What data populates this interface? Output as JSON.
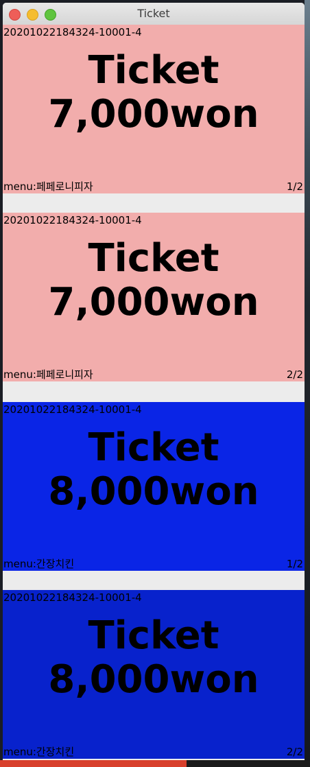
{
  "window": {
    "title": "Ticket"
  },
  "tickets": [
    {
      "order_id": "20201022184324-10001-4",
      "label": "Ticket",
      "price": "7,000won",
      "menu_prefix": "menu:",
      "menu_name": "페페로니피자",
      "page": "1/2",
      "color": "#f2adac"
    },
    {
      "order_id": "20201022184324-10001-4",
      "label": "Ticket",
      "price": "7,000won",
      "menu_prefix": "menu:",
      "menu_name": "페페로니피자",
      "page": "2/2",
      "color": "#f2adac"
    },
    {
      "order_id": "20201022184324-10001-4",
      "label": "Ticket",
      "price": "8,000won",
      "menu_prefix": "menu:",
      "menu_name": "간장치킨",
      "page": "1/2",
      "color": "#0a25e6"
    },
    {
      "order_id": "20201022184324-10001-4",
      "label": "Ticket",
      "price": "8,000won",
      "menu_prefix": "menu:",
      "menu_name": "간장치킨",
      "page": "2/2",
      "color": "#0822cc"
    }
  ]
}
